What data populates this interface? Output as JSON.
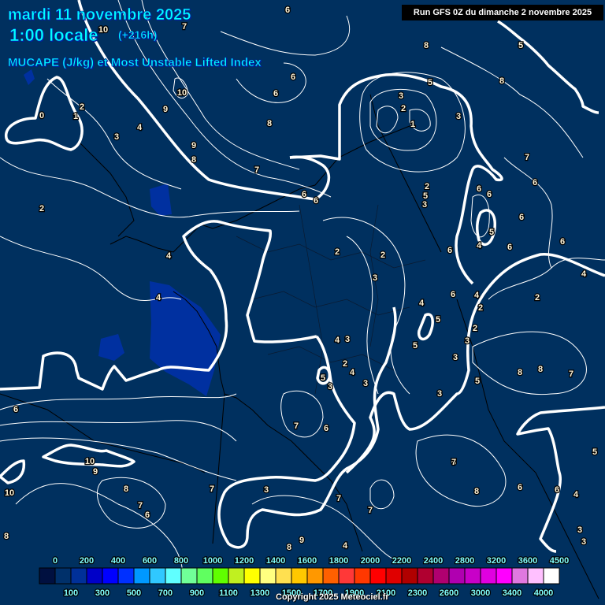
{
  "header": {
    "date": "mardi 11 novembre 2025",
    "time": "1:00 locale",
    "lead": "(+216h)",
    "parameter": "MUCAPE (J/kg) et Most Unstable Lifted Index",
    "run": "Run GFS 0Z du dimanche 2 novembre 2025"
  },
  "map": {
    "background_color": "#00305f",
    "cape_patch_color": "#0030a0",
    "contour_labels": [
      "6",
      "7",
      "8",
      "5",
      "10",
      "8",
      "5",
      "6",
      "6",
      "10",
      "9",
      "2",
      "0",
      "1",
      "3",
      "3",
      "1",
      "2",
      "8",
      "4",
      "3",
      "9",
      "8",
      "7",
      "7",
      "6",
      "6",
      "6",
      "2",
      "6",
      "6",
      "5",
      "3",
      "4",
      "2",
      "6",
      "5",
      "4",
      "6",
      "6",
      "2",
      "2",
      "6",
      "4",
      "3",
      "4",
      "6",
      "4",
      "2",
      "4",
      "3",
      "2",
      "5",
      "2",
      "3",
      "4",
      "3",
      "5",
      "2",
      "3",
      "4",
      "5",
      "3",
      "5",
      "8",
      "8",
      "7",
      "6",
      "3",
      "6",
      "7",
      "6",
      "10",
      "9",
      "7",
      "8",
      "10",
      "7",
      "3",
      "8",
      "6",
      "6",
      "4",
      "7",
      "6",
      "7",
      "7",
      "3",
      "3",
      "8",
      "8",
      "9",
      "4",
      "5"
    ]
  },
  "legend": {
    "colors": [
      "#001040",
      "#00306a",
      "#003098",
      "#0000c8",
      "#0000ff",
      "#0030ff",
      "#0098ff",
      "#30c8ff",
      "#60ffff",
      "#70ff98",
      "#60ff60",
      "#60ff00",
      "#c0f020",
      "#ffff00",
      "#ffff80",
      "#ffe050",
      "#ffc800",
      "#ff9800",
      "#ff6000",
      "#ff3838",
      "#ff3800",
      "#ff0000",
      "#e00000",
      "#b00000",
      "#b00030",
      "#b00070",
      "#b000b0",
      "#c800c8",
      "#e000e0",
      "#ff00ff",
      "#e078e0",
      "#ffc0ff",
      "#ffffff"
    ],
    "labels": [
      "0",
      "100",
      "200",
      "300",
      "400",
      "500",
      "600",
      "700",
      "800",
      "900",
      "1000",
      "1100",
      "1200",
      "1300",
      "1400",
      "1500",
      "1600",
      "1700",
      "1800",
      "1900",
      "2000",
      "2100",
      "2200",
      "2300",
      "2400",
      "2600",
      "2800",
      "3000",
      "3200",
      "3400",
      "3600",
      "4000",
      "4500"
    ]
  },
  "footer": {
    "copyright": "Copyright 2025 Meteociel.fr"
  }
}
